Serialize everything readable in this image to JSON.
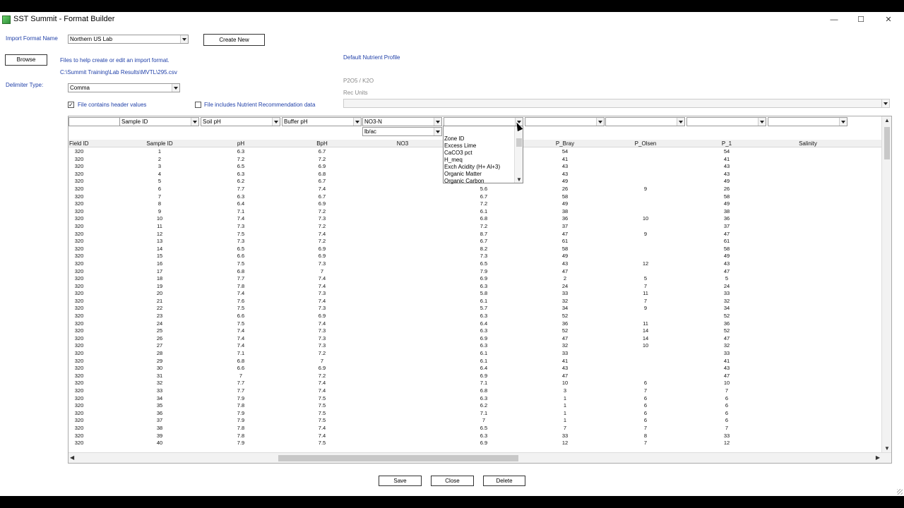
{
  "window": {
    "title": "SST Summit - Format Builder",
    "minimize": "—",
    "maximize": "☐",
    "close": "✕"
  },
  "import_format": {
    "label": "Import Format Name",
    "value": "Northern US Lab",
    "create_new": "Create New"
  },
  "files": {
    "browse": "Browse",
    "hint": "Files to help create or edit an import format.",
    "path": "C:\\Summit Training\\Lab Results\\MVTL\\295.csv"
  },
  "nutrient": {
    "default_profile": "Default Nutrient Profile",
    "p2o5_k2o": "P2O5 / K2O",
    "rec_units": "Rec Units"
  },
  "delimiter": {
    "label": "Delimiter Type:",
    "value": "Comma"
  },
  "checks": {
    "header_values": "File contains header values",
    "header_checked": "✓",
    "nutrient_rec": "File includes Nutrient Recommendation data"
  },
  "header_dropdowns": [
    "",
    "Sample ID",
    "Soil pH",
    "Buffer pH",
    "NO3-N",
    "",
    "",
    "",
    "",
    ""
  ],
  "unit_dropdown": "lb/ac",
  "columns": [
    "Field ID",
    "Sample ID",
    "pH",
    "BpH",
    "NO3",
    "",
    "P_Bray",
    "P_Olsen",
    "P_1",
    "Salinity"
  ],
  "rows": [
    [
      "320",
      "1",
      "6.3",
      "6.7",
      "",
      "",
      "54",
      "",
      "54",
      ""
    ],
    [
      "320",
      "2",
      "7.2",
      "7.2",
      "",
      "",
      "41",
      "",
      "41",
      ""
    ],
    [
      "320",
      "3",
      "6.5",
      "6.9",
      "",
      "",
      "43",
      "",
      "43",
      ""
    ],
    [
      "320",
      "4",
      "6.3",
      "6.8",
      "",
      "",
      "43",
      "",
      "43",
      ""
    ],
    [
      "320",
      "5",
      "6.2",
      "6.7",
      "",
      "",
      "49",
      "",
      "49",
      ""
    ],
    [
      "320",
      "6",
      "7.7",
      "7.4",
      "",
      "5.6",
      "26",
      "9",
      "26",
      ""
    ],
    [
      "320",
      "7",
      "6.3",
      "6.7",
      "",
      "6.7",
      "58",
      "",
      "58",
      ""
    ],
    [
      "320",
      "8",
      "6.4",
      "6.9",
      "",
      "7.2",
      "49",
      "",
      "49",
      ""
    ],
    [
      "320",
      "9",
      "7.1",
      "7.2",
      "",
      "6.1",
      "38",
      "",
      "38",
      ""
    ],
    [
      "320",
      "10",
      "7.4",
      "7.3",
      "",
      "6.8",
      "36",
      "10",
      "36",
      ""
    ],
    [
      "320",
      "11",
      "7.3",
      "7.2",
      "",
      "7.2",
      "37",
      "",
      "37",
      ""
    ],
    [
      "320",
      "12",
      "7.5",
      "7.4",
      "",
      "8.7",
      "47",
      "9",
      "47",
      ""
    ],
    [
      "320",
      "13",
      "7.3",
      "7.2",
      "",
      "6.7",
      "61",
      "",
      "61",
      ""
    ],
    [
      "320",
      "14",
      "6.5",
      "6.9",
      "",
      "8.2",
      "58",
      "",
      "58",
      ""
    ],
    [
      "320",
      "15",
      "6.6",
      "6.9",
      "",
      "7.3",
      "49",
      "",
      "49",
      ""
    ],
    [
      "320",
      "16",
      "7.5",
      "7.3",
      "",
      "6.5",
      "43",
      "12",
      "43",
      ""
    ],
    [
      "320",
      "17",
      "6.8",
      "7",
      "",
      "7.9",
      "47",
      "",
      "47",
      ""
    ],
    [
      "320",
      "18",
      "7.7",
      "7.4",
      "",
      "6.9",
      "2",
      "5",
      "5",
      ""
    ],
    [
      "320",
      "19",
      "7.8",
      "7.4",
      "",
      "6.3",
      "24",
      "7",
      "24",
      ""
    ],
    [
      "320",
      "20",
      "7.4",
      "7.3",
      "",
      "5.8",
      "33",
      "11",
      "33",
      ""
    ],
    [
      "320",
      "21",
      "7.6",
      "7.4",
      "",
      "6.1",
      "32",
      "7",
      "32",
      ""
    ],
    [
      "320",
      "22",
      "7.5",
      "7.3",
      "",
      "5.7",
      "34",
      "9",
      "34",
      ""
    ],
    [
      "320",
      "23",
      "6.6",
      "6.9",
      "",
      "6.3",
      "52",
      "",
      "52",
      ""
    ],
    [
      "320",
      "24",
      "7.5",
      "7.4",
      "",
      "6.4",
      "36",
      "11",
      "36",
      ""
    ],
    [
      "320",
      "25",
      "7.4",
      "7.3",
      "",
      "6.3",
      "52",
      "14",
      "52",
      ""
    ],
    [
      "320",
      "26",
      "7.4",
      "7.3",
      "",
      "6.9",
      "47",
      "14",
      "47",
      ""
    ],
    [
      "320",
      "27",
      "7.4",
      "7.3",
      "",
      "6.3",
      "32",
      "10",
      "32",
      ""
    ],
    [
      "320",
      "28",
      "7.1",
      "7.2",
      "",
      "6.1",
      "33",
      "",
      "33",
      ""
    ],
    [
      "320",
      "29",
      "6.8",
      "7",
      "",
      "6.1",
      "41",
      "",
      "41",
      ""
    ],
    [
      "320",
      "30",
      "6.6",
      "6.9",
      "",
      "6.4",
      "43",
      "",
      "43",
      ""
    ],
    [
      "320",
      "31",
      "7",
      "7.2",
      "",
      "6.9",
      "47",
      "",
      "47",
      ""
    ],
    [
      "320",
      "32",
      "7.7",
      "7.4",
      "",
      "7.1",
      "10",
      "6",
      "10",
      ""
    ],
    [
      "320",
      "33",
      "7.7",
      "7.4",
      "",
      "6.8",
      "3",
      "7",
      "7",
      ""
    ],
    [
      "320",
      "34",
      "7.9",
      "7.5",
      "",
      "6.3",
      "1",
      "6",
      "6",
      ""
    ],
    [
      "320",
      "35",
      "7.8",
      "7.5",
      "",
      "6.2",
      "1",
      "6",
      "6",
      ""
    ],
    [
      "320",
      "36",
      "7.9",
      "7.5",
      "",
      "7.1",
      "1",
      "6",
      "6",
      ""
    ],
    [
      "320",
      "37",
      "7.9",
      "7.5",
      "",
      "7",
      "1",
      "6",
      "6",
      ""
    ],
    [
      "320",
      "38",
      "7.8",
      "7.4",
      "",
      "6.5",
      "7",
      "7",
      "7",
      ""
    ],
    [
      "320",
      "39",
      "7.8",
      "7.4",
      "",
      "6.3",
      "33",
      "8",
      "33",
      ""
    ],
    [
      "320",
      "40",
      "7.9",
      "7.5",
      "",
      "6.9",
      "12",
      "7",
      "12",
      ""
    ]
  ],
  "popup_items": [
    "Zone ID",
    "Excess Lime",
    "CaCO3 pct",
    "H_meq",
    "Exch Acidity (H+ Al+3)",
    "Organic Matter",
    "Organic Carbon"
  ],
  "footer": {
    "save": "Save",
    "close": "Close",
    "delete": "Delete"
  }
}
